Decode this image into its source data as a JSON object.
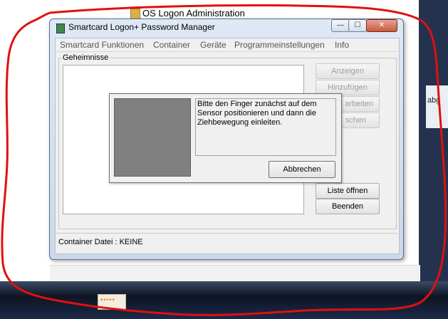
{
  "background": {
    "window_title": "OS Logon Administration",
    "tray_text": "abg"
  },
  "window": {
    "title": "Smartcard Logon+ Password Manager",
    "controls": {
      "minimize": "—",
      "maximize": "☐",
      "close": "✕"
    }
  },
  "menu": [
    "Smartcard Funktionen",
    "Container",
    "Geräte",
    "Programmeinstellungen",
    "Info"
  ],
  "group_label": "Geheimnisse",
  "side_buttons": {
    "anzeigen": "Anzeigen",
    "hinzufuegen": "Hinzufügen",
    "bearbeiten": "arbeiten",
    "loeschen": "schen",
    "liste_oeffnen": "Liste öffnen",
    "beenden": "Beenden"
  },
  "status": "Container Datei : KEINE",
  "dialog": {
    "message": "Bitte den Finger zunächst auf dem Sensor positionieren und dann die Ziehbewegung einleiten.",
    "cancel": "Abbrechen"
  },
  "colors": {
    "annotation": "#e01010",
    "finger_area": "#808080"
  }
}
